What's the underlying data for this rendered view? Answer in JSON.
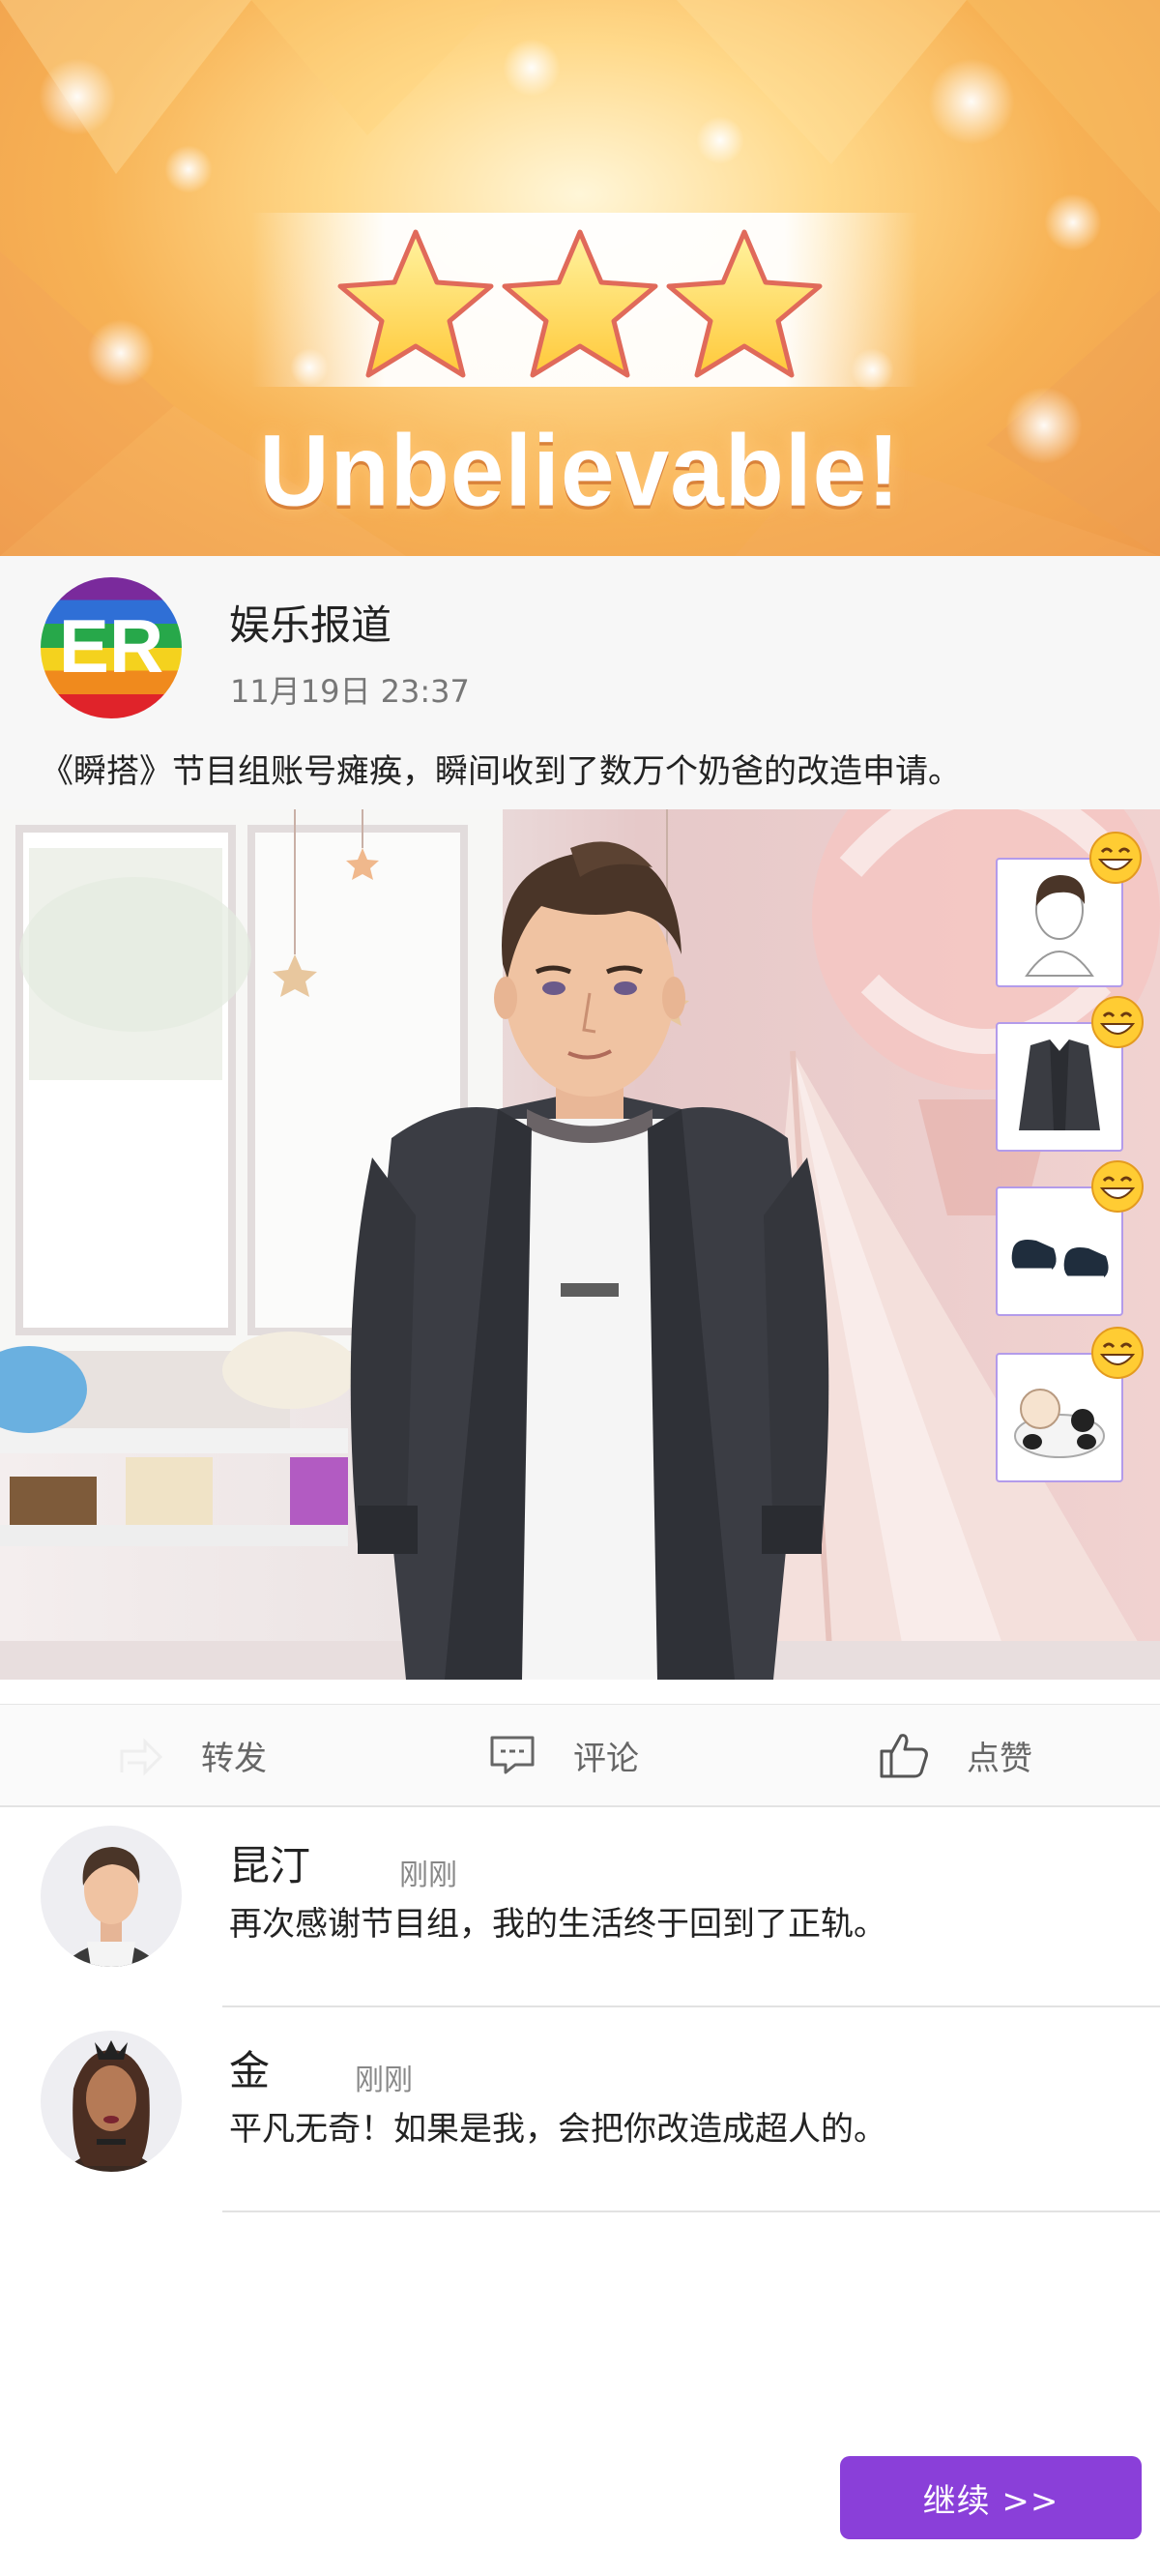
{
  "result": {
    "headline": "Unbelievable!",
    "stars_earned": 3,
    "stars_total": 3
  },
  "post": {
    "avatar_text": "ER",
    "author": "娱乐报道",
    "timestamp": "11月19日 23:37",
    "text": "《瞬搭》节目组账号瘫痪，瞬间收到了数万个奶爸的改造申请。"
  },
  "outfit_items": [
    {
      "icon": "hair-icon",
      "rating": "grin-emoji-icon"
    },
    {
      "icon": "jacket-icon",
      "rating": "grin-emoji-icon"
    },
    {
      "icon": "shoes-icon",
      "rating": "grin-emoji-icon"
    },
    {
      "icon": "panda-plush-icon",
      "rating": "grin-emoji-icon"
    }
  ],
  "actions": {
    "share_label": "转发",
    "comment_label": "评论",
    "like_label": "点赞"
  },
  "comments": [
    {
      "name": "昆汀",
      "time": "刚刚",
      "text": "再次感谢节目组，我的生活终于回到了正轨。"
    },
    {
      "name": "金",
      "time": "刚刚",
      "text": "平凡无奇！如果是我，会把你改造成超人的。"
    }
  ],
  "continue_label": "继续 >>",
  "colors": {
    "accent": "#8a3fd9",
    "slot_border": "#b39bea",
    "star_fill": "#ffd84a"
  }
}
